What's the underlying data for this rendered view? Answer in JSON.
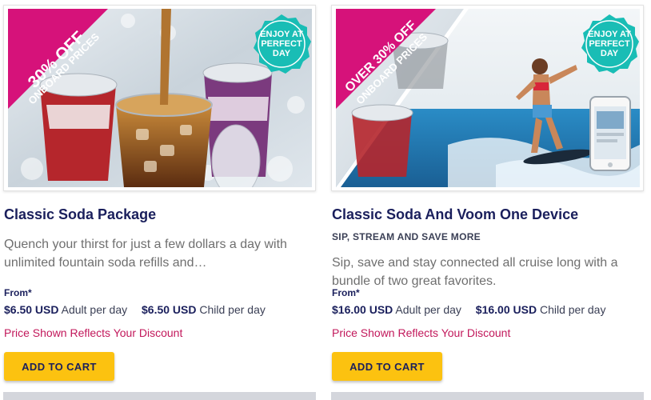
{
  "cards": [
    {
      "promo": "30% OFF",
      "promo_sub": "ONBOARD PRICES",
      "badge": "ENJOY AT PERFECT DAY",
      "title": "Classic Soda Package",
      "subtitle": "",
      "description": "Quench your thirst for just a few dollars a day with unlimited fountain soda refills and…",
      "from_label": "From*",
      "adult_price": "$6.50 USD",
      "adult_unit": "Adult per day",
      "child_price": "$6.50 USD",
      "child_unit": "Child per day",
      "discount_note": "Price Shown Reflects Your Discount",
      "cta": "ADD TO CART"
    },
    {
      "promo": "OVER 30% OFF",
      "promo_sub": "ONBOARD PRICES",
      "badge": "ENJOY AT PERFECT DAY",
      "title": "Classic Soda And Voom One Device",
      "subtitle": "SIP, STREAM AND SAVE MORE",
      "description": "Sip, save and stay connected all cruise long with a bundle of two great favorites.",
      "from_label": "From*",
      "adult_price": "$16.00 USD",
      "adult_unit": "Adult per day",
      "child_price": "$16.00 USD",
      "child_unit": "Child per day",
      "discount_note": "Price Shown Reflects Your Discount",
      "cta": "ADD TO CART"
    }
  ],
  "colors": {
    "promo_ribbon": "#d6127a",
    "badge": "#19bdb5",
    "cta": "#fcc210",
    "title": "#1a1f5c",
    "discount": "#c2185b"
  }
}
